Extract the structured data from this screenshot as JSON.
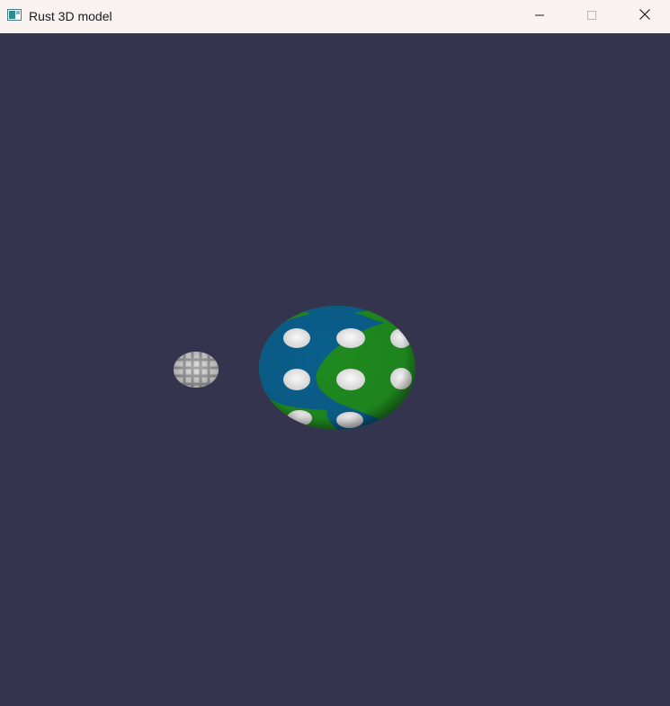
{
  "window": {
    "title": "Rust 3D model",
    "icon": "app-window-icon",
    "controls": [
      "minimize-icon",
      "maximize-icon",
      "close-icon"
    ]
  },
  "scene": {
    "background_color": "#35344f",
    "objects": [
      {
        "name": "textured-planet",
        "colors": [
          "#1f8a1f",
          "#0a5f8c",
          "#f2f2f2"
        ]
      },
      {
        "name": "small-moon",
        "colors": [
          "#cfcfcf",
          "#8a8a8a"
        ]
      }
    ]
  }
}
